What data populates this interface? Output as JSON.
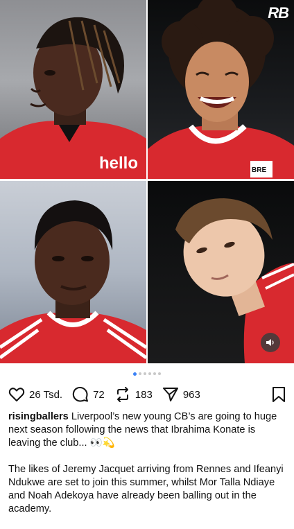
{
  "post": {
    "watermark": "RB",
    "images": [
      {
        "name": "player-photo-1"
      },
      {
        "name": "player-photo-2"
      },
      {
        "name": "player-photo-3"
      },
      {
        "name": "player-photo-4"
      }
    ],
    "jersey_sponsor_text": "hello",
    "jersey_badge_text": "BRE",
    "carousel": {
      "count": 6,
      "active_index": 0
    }
  },
  "actions": {
    "likes": "26 Tsd.",
    "comments": "72",
    "reposts": "183",
    "shares": "963"
  },
  "caption": {
    "username": "risingballers",
    "text1": "Liverpool’s new young CB’s are going to huge next season following the news that Ibrahima Konate is leaving the club... 👀💫",
    "text2": "The likes of Jeremy Jacquet arriving from Rennes and Ifeanyi Ndukwe are set to join this summer, whilst Mor Talla Ndiaye and Noah Adekoya have already been balling out in the academy."
  },
  "colors": {
    "accent": "#3b82f6",
    "kit_red": "#d8292f"
  }
}
